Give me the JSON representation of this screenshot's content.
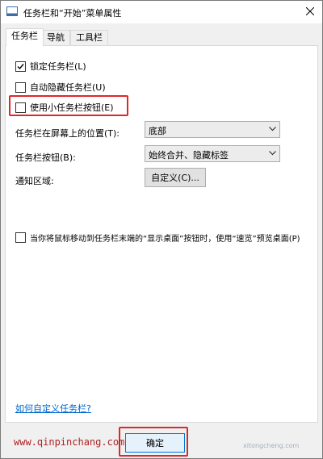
{
  "window": {
    "title": "任务栏和“开始”菜单属性"
  },
  "tabs": [
    {
      "label": "任务栏",
      "active": true
    },
    {
      "label": "导航",
      "active": false
    },
    {
      "label": "工具栏",
      "active": false
    }
  ],
  "checkboxes": {
    "lock_taskbar": {
      "label": "锁定任务栏(L)",
      "checked": true
    },
    "auto_hide": {
      "label": "自动隐藏任务栏(U)",
      "checked": false
    },
    "small_buttons": {
      "label": "使用小任务栏按钮(E)",
      "checked": false
    },
    "peek": {
      "label": "当你将鼠标移动到任务栏末端的“显示桌面”按钮时，使用“速览”预览桌面(P)",
      "checked": false
    }
  },
  "settings": {
    "position": {
      "label": "任务栏在屏幕上的位置(T):",
      "value": "底部"
    },
    "buttons": {
      "label": "任务栏按钮(B):",
      "value": "始终合并、隐藏标签"
    },
    "notification": {
      "label": "通知区域:",
      "button_label": "自定义(C)..."
    }
  },
  "help_link": "如何自定义任务栏?",
  "ok_button": "确定",
  "watermark_url": "www.qinpinchang.com",
  "watermark_logo": "xitongcheng.com",
  "colors": {
    "highlight": "#e0262b",
    "link": "#0066cc",
    "url": "#b02222"
  }
}
